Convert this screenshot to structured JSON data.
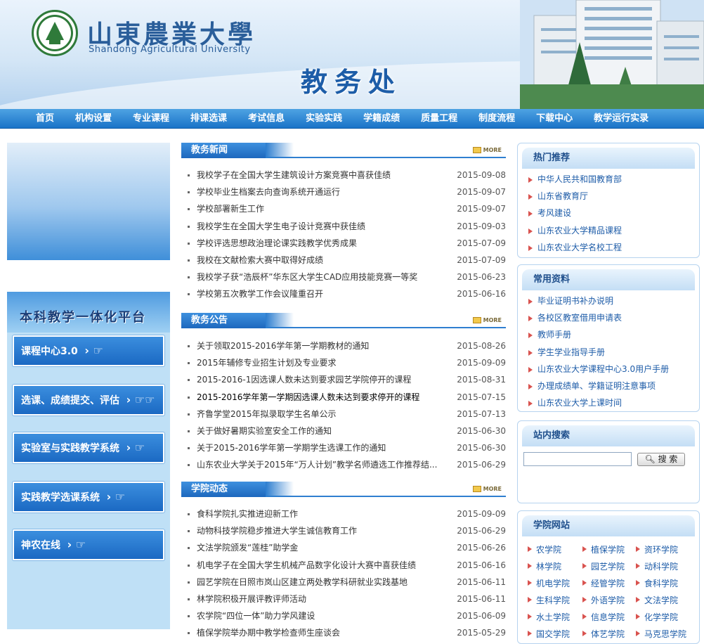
{
  "header": {
    "university_cn": "山東農業大學",
    "university_en": "Shandong Agricultural University",
    "site_title": "教务处"
  },
  "nav": [
    "首页",
    "机构设置",
    "专业课程",
    "排课选课",
    "考试信息",
    "实验实践",
    "学籍成绩",
    "质量工程",
    "制度流程",
    "下载中心",
    "教学运行实录"
  ],
  "platform": {
    "title": "本科教学一体化平台",
    "buttons": [
      "课程中心3.0",
      "选课、成绩提交、评估",
      "实验室与实践教学系统",
      "实践教学选课系统",
      "神农在线"
    ]
  },
  "more_label": "MORE",
  "news": {
    "title": "教务新闻",
    "items": [
      {
        "title": "我校学子在全国大学生建筑设计方案竞赛中喜获佳绩",
        "date": "2015-09-08"
      },
      {
        "title": "学校毕业生档案去向查询系统开通运行",
        "date": "2015-09-07"
      },
      {
        "title": "学校部署新生工作",
        "date": "2015-09-07"
      },
      {
        "title": "我校学生在全国大学生电子设计竞赛中获佳绩",
        "date": "2015-09-03"
      },
      {
        "title": "学校评选思想政治理论课实践教学优秀成果",
        "date": "2015-07-09"
      },
      {
        "title": "我校在文献检索大赛中取得好成绩",
        "date": "2015-07-09"
      },
      {
        "title": "我校学子获“浩辰杯”华东区大学生CAD应用技能竞赛一等奖",
        "date": "2015-06-23"
      },
      {
        "title": "学校第五次教学工作会议隆重召开",
        "date": "2015-06-16"
      }
    ]
  },
  "notices": {
    "title": "教务公告",
    "items": [
      {
        "title": "关于领取2015-2016学年第一学期教材的通知",
        "date": "2015-08-26"
      },
      {
        "title": "2015年辅修专业招生计划及专业要求",
        "date": "2015-09-09"
      },
      {
        "title": "2015-2016-1因选课人数未达到要求园艺学院停开的课程",
        "date": "2015-08-31"
      },
      {
        "title": "2015-2016学年第一学期因选课人数未达到要求停开的课程",
        "date": "2015-07-15"
      },
      {
        "title": "齐鲁学堂2015年拟录取学生名单公示",
        "date": "2015-07-13"
      },
      {
        "title": "关于做好暑期实验室安全工作的通知",
        "date": "2015-06-30"
      },
      {
        "title": "关于2015-2016学年第一学期学生选课工作的通知",
        "date": "2015-06-30"
      },
      {
        "title": "山东农业大学关于2015年“万人计划”教学名师遴选工作推荐结...",
        "date": "2015-06-29"
      }
    ]
  },
  "college_news": {
    "title": "学院动态",
    "items": [
      {
        "title": "食科学院扎实推进迎新工作",
        "date": "2015-09-09"
      },
      {
        "title": "动物科技学院稳步推进大学生诚信教育工作",
        "date": "2015-06-29"
      },
      {
        "title": "文法学院颁发“莲桂”助学金",
        "date": "2015-06-26"
      },
      {
        "title": "机电学子在全国大学生机械产品数字化设计大赛中喜获佳绩",
        "date": "2015-06-16"
      },
      {
        "title": "园艺学院在日照市岚山区建立两处教学科研就业实践基地",
        "date": "2015-06-11"
      },
      {
        "title": "林学院积极开展评教评师活动",
        "date": "2015-06-11"
      },
      {
        "title": "农学院“四位一体”助力学风建设",
        "date": "2015-06-09"
      },
      {
        "title": "植保学院举办期中教学检查师生座谈会",
        "date": "2015-05-29"
      }
    ]
  },
  "hot": {
    "title": "热门推荐",
    "items": [
      "中华人民共和国教育部",
      "山东省教育厅",
      "考风建设",
      "山东农业大学精品课程",
      "山东农业大学名校工程"
    ]
  },
  "resources": {
    "title": "常用资料",
    "items": [
      "毕业证明书补办说明",
      "各校区教室借用申请表",
      "教师手册",
      "学生学业指导手册",
      "山东农业大学课程中心3.0用户手册",
      "办理成绩单、学籍证明注意事项",
      "山东农业大学上课时间"
    ]
  },
  "search": {
    "title": "站内搜索",
    "value": "",
    "button": "搜 索"
  },
  "colleges": {
    "title": "学院网站",
    "items": [
      "农学院",
      "植保学院",
      "资环学院",
      "林学院",
      "园艺学院",
      "动科学院",
      "机电学院",
      "经管学院",
      "食科学院",
      "生科学院",
      "外语学院",
      "文法学院",
      "水土学院",
      "信息学院",
      "化学学院",
      "国交学院",
      "体艺学院",
      "马克思学院"
    ]
  }
}
